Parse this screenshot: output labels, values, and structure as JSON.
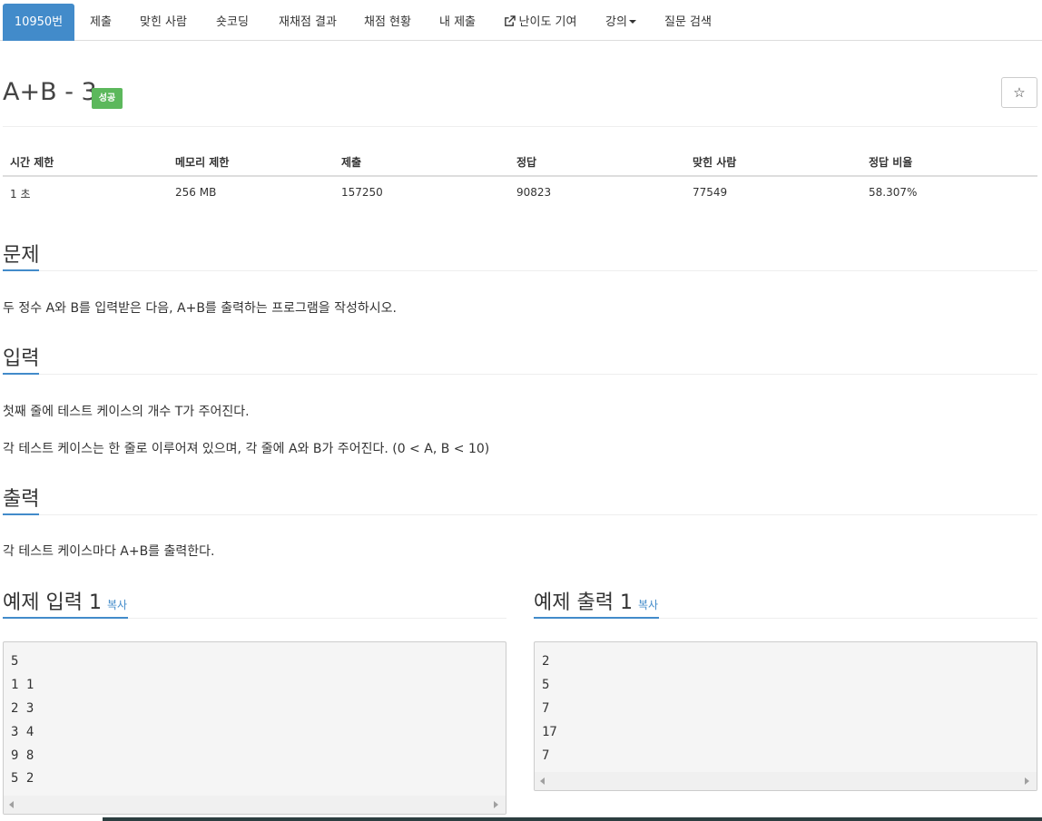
{
  "nav": {
    "tabs": [
      {
        "label": "10950번"
      },
      {
        "label": "제출"
      },
      {
        "label": "맞힌 사람"
      },
      {
        "label": "숏코딩"
      },
      {
        "label": "재채점 결과"
      },
      {
        "label": "채점 현황"
      },
      {
        "label": "내 제출"
      },
      {
        "label": "난이도 기여"
      },
      {
        "label": "강의"
      },
      {
        "label": "질문 검색"
      }
    ]
  },
  "problem": {
    "title": "A+B - 3",
    "badge": "성공",
    "star_icon": "☆"
  },
  "stats": {
    "headers": [
      "시간 제한",
      "메모리 제한",
      "제출",
      "정답",
      "맞힌 사람",
      "정답 비율"
    ],
    "values": [
      "1 초",
      "256 MB",
      "157250",
      "90823",
      "77549",
      "58.307%"
    ]
  },
  "sections": {
    "problem": {
      "title": "문제",
      "text": "두 정수 A와 B를 입력받은 다음, A+B를 출력하는 프로그램을 작성하시오."
    },
    "input": {
      "title": "입력",
      "text1": "첫째 줄에 테스트 케이스의 개수 T가 주어진다.",
      "text2": "각 테스트 케이스는 한 줄로 이루어져 있으며, 각 줄에 A와 B가 주어진다. (0 < A, B < 10)"
    },
    "output": {
      "title": "출력",
      "text": "각 테스트 케이스마다 A+B를 출력한다."
    }
  },
  "samples": {
    "input": {
      "title": "예제 입력 1",
      "copy_label": "복사",
      "lines": [
        "5",
        "1 1",
        "2 3",
        "3 4",
        "9 8",
        "5 2"
      ]
    },
    "output": {
      "title": "예제 출력 1",
      "copy_label": "복사",
      "lines": [
        "2",
        "5",
        "7",
        "17",
        "7"
      ]
    }
  },
  "colors": {
    "accent": "#428bca",
    "success": "#5cb85c"
  }
}
